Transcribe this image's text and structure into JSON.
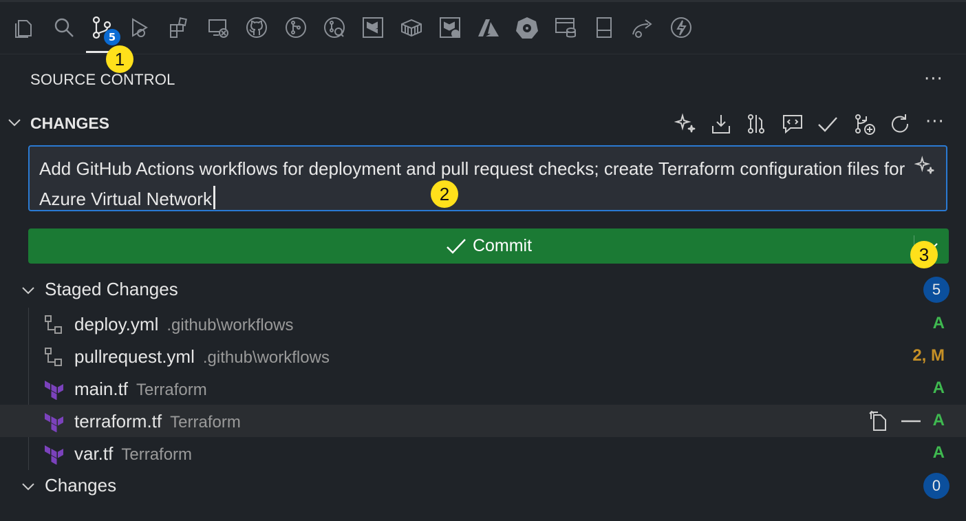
{
  "activity_bar": {
    "items": [
      "explorer-icon",
      "search-icon",
      "source-control-icon",
      "run-debug-icon",
      "extensions-icon",
      "remote-explorer-icon",
      "github-icon",
      "git-graph-icon",
      "git-history-icon",
      "terraform-icon",
      "containers-icon",
      "terraform-cloud-icon",
      "azure-icon",
      "kubernetes-icon",
      "database-icon",
      "sidebar-panel-icon",
      "live-share-icon",
      "thunder-icon"
    ],
    "scm_badge": "5"
  },
  "callouts": [
    "1",
    "2",
    "3"
  ],
  "panel": {
    "title": "SOURCE CONTROL",
    "more": "···"
  },
  "changes_section": {
    "title": "CHANGES",
    "more": "···",
    "toolbar": [
      "sparkle-generate-icon",
      "fetch-icon",
      "compare-icon",
      "chat-comment-icon",
      "commit-check-icon",
      "branch-add-icon",
      "refresh-icon"
    ]
  },
  "commit_message": {
    "text": "Add GitHub Actions workflows for deployment and pull request checks; create Terraform configuration files for Azure Virtual Network"
  },
  "commit_button": {
    "label": "Commit"
  },
  "staged": {
    "label": "Staged Changes",
    "count": "5",
    "files": [
      {
        "name": "deploy.yml",
        "dir": ".github\\workflows",
        "status": "A",
        "status_color": "#3fb950",
        "icon": "workflow-icon"
      },
      {
        "name": "pullrequest.yml",
        "dir": ".github\\workflows",
        "status": "2, M",
        "status_color": "#c69026",
        "icon": "workflow-icon"
      },
      {
        "name": "main.tf",
        "dir": "Terraform",
        "status": "A",
        "status_color": "#3fb950",
        "icon": "terraform-file-icon"
      },
      {
        "name": "terraform.tf",
        "dir": "Terraform",
        "status": "A",
        "status_color": "#3fb950",
        "icon": "terraform-file-icon"
      },
      {
        "name": "var.tf",
        "dir": "Terraform",
        "status": "A",
        "status_color": "#3fb950",
        "icon": "terraform-file-icon"
      }
    ]
  },
  "changes": {
    "label": "Changes",
    "count": "0"
  },
  "colors": {
    "background": "#1f2328",
    "accent_blue": "#2a7ad3",
    "commit_green": "#1b7a34",
    "badge_blue": "#0b4f9c",
    "callout_yellow": "#ffe01b",
    "terraform_purple": "#7b42bc"
  }
}
